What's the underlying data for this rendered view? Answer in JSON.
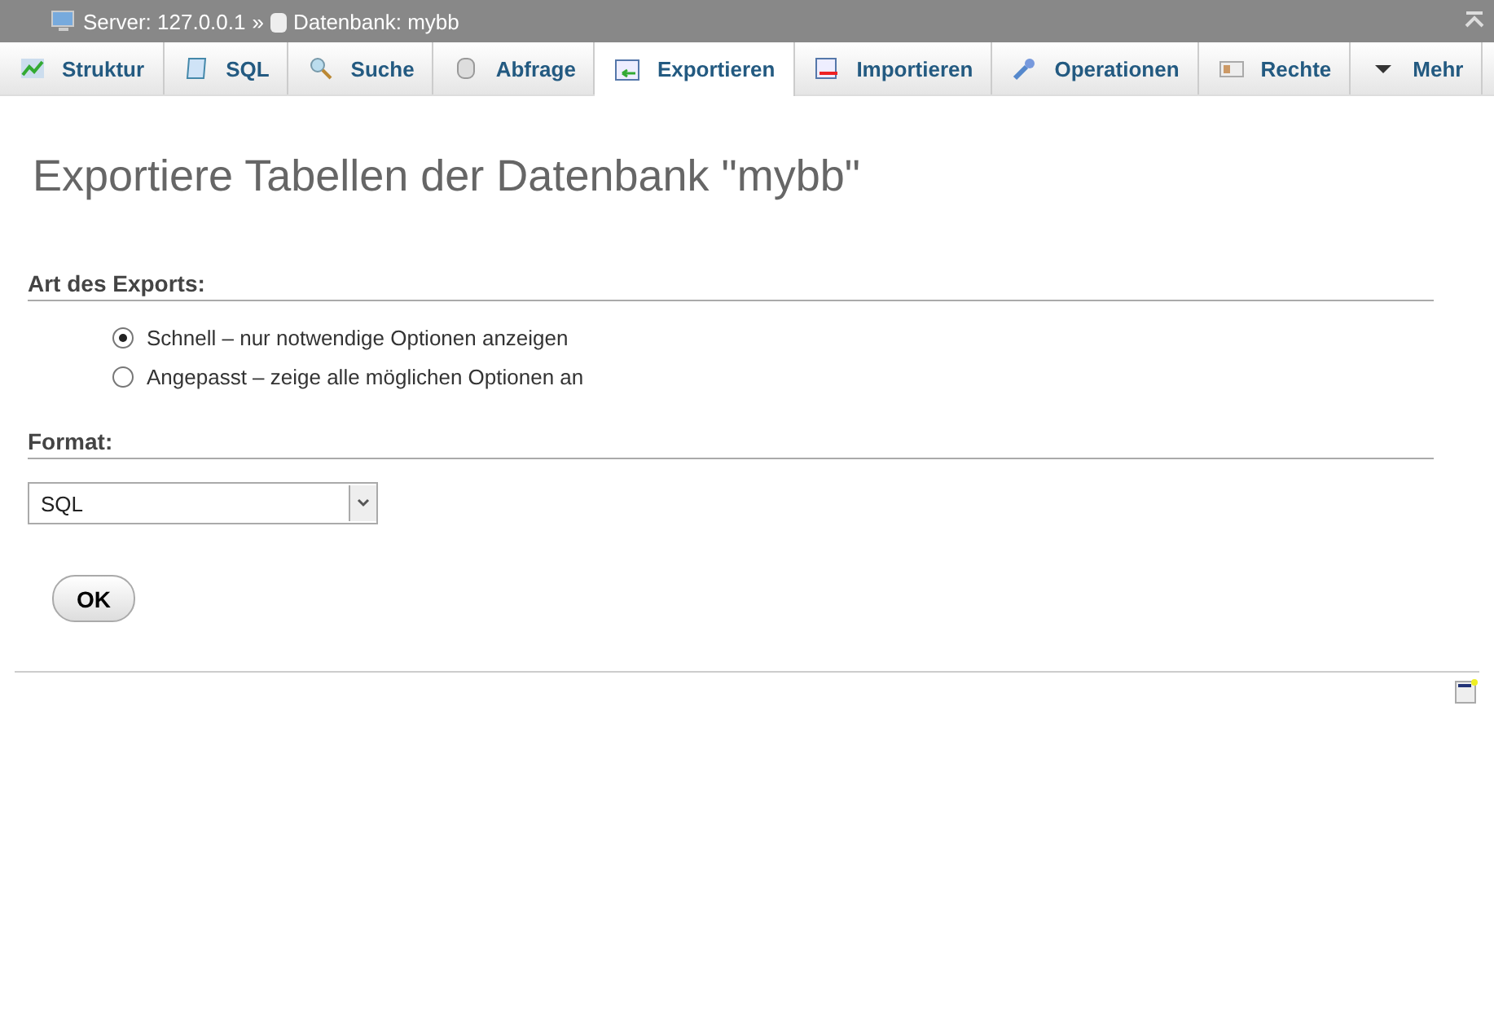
{
  "breadcrumb": {
    "server": "Server: 127.0.0.1",
    "separator": "»",
    "database": "Datenbank: mybb"
  },
  "tabs": [
    {
      "label": "Struktur",
      "selected": false
    },
    {
      "label": "SQL",
      "selected": false
    },
    {
      "label": "Suche",
      "selected": false
    },
    {
      "label": "Abfrage",
      "selected": false
    },
    {
      "label": "Exportieren",
      "selected": true
    },
    {
      "label": "Importieren",
      "selected": false
    },
    {
      "label": "Operationen",
      "selected": false
    },
    {
      "label": "Rechte",
      "selected": false
    },
    {
      "label": "Mehr",
      "selected": false
    }
  ],
  "title": "Exportiere Tabellen der Datenbank \"mybb\"",
  "export_type": {
    "heading": "Art des Exports:",
    "options": [
      {
        "label": "Schnell – nur notwendige Optionen anzeigen",
        "selected": true
      },
      {
        "label": "Angepasst – zeige alle möglichen Optionen an",
        "selected": false
      }
    ]
  },
  "format": {
    "heading": "Format:",
    "value": "SQL"
  },
  "ok_button": "OK"
}
